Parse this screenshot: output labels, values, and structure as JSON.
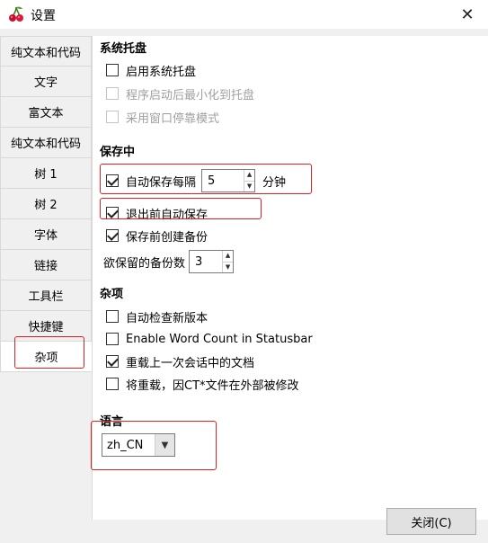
{
  "window": {
    "title": "设置",
    "close_glyph": "✕"
  },
  "tabs": [
    {
      "label": "纯文本和代码"
    },
    {
      "label": "文字"
    },
    {
      "label": "富文本"
    },
    {
      "label": "纯文本和代码"
    },
    {
      "label": "树 1"
    },
    {
      "label": "树 2"
    },
    {
      "label": "字体"
    },
    {
      "label": "链接"
    },
    {
      "label": "工具栏"
    },
    {
      "label": "快捷键"
    },
    {
      "label": "杂项"
    }
  ],
  "active_tab": "杂项",
  "tray": {
    "title": "系统托盘",
    "enable": {
      "label": "启用系统托盘",
      "checked": false
    },
    "start_min": {
      "label": "程序启动后最小化到托盘",
      "checked": false,
      "disabled": true
    },
    "dock_mode": {
      "label": "采用窗口停靠模式",
      "checked": false,
      "disabled": true
    }
  },
  "saving": {
    "title": "保存中",
    "autosave": {
      "label": "自动保存每隔",
      "checked": true,
      "value": "5",
      "unit": "分钟"
    },
    "save_on_exit": {
      "label": "退出前自动保存",
      "checked": true
    },
    "backup": {
      "label": "保存前创建备份",
      "checked": true
    },
    "backup_count": {
      "label": "欲保留的备份数",
      "value": "3"
    }
  },
  "misc": {
    "title": "杂项",
    "check_updates": {
      "label": "自动检查新版本",
      "checked": false
    },
    "word_count": {
      "label": "Enable Word Count in Statusbar",
      "checked": false
    },
    "reload_session": {
      "label": "重载上一次会话中的文档",
      "checked": true
    },
    "reload_modified": {
      "label": "将重载，因CT*文件在外部被修改",
      "checked": false
    }
  },
  "language": {
    "title": "语言",
    "value": "zh_CN"
  },
  "footer": {
    "close_label": "关闭(C)"
  },
  "colors": {
    "highlight": "#e02020"
  }
}
